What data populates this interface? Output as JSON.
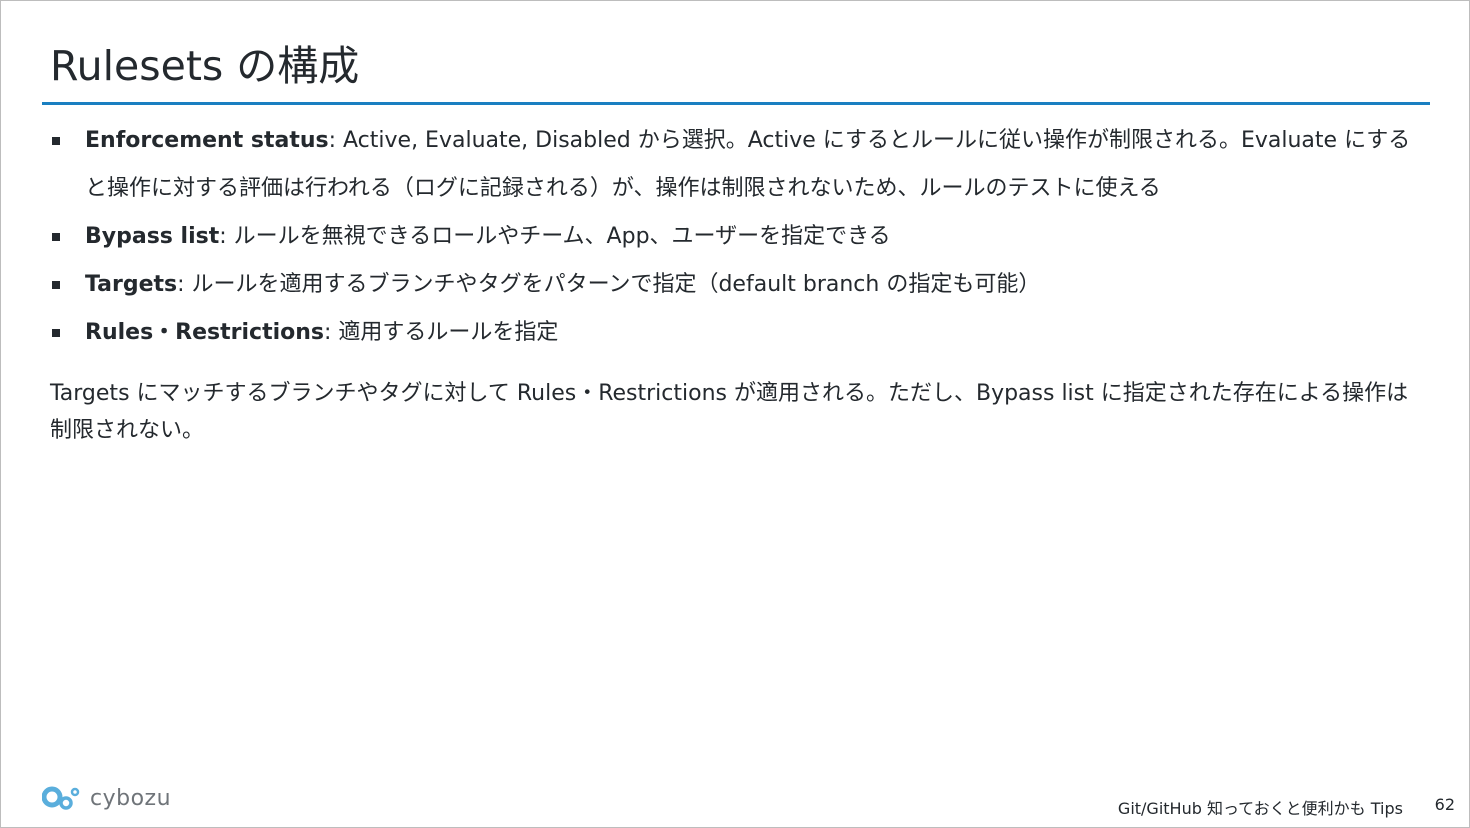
{
  "slide": {
    "title": "Rulesets の構成",
    "bullets": [
      {
        "term": "Enforcement status",
        "text": ": Active, Evaluate, Disabled から選択。Active にするとルールに従い操作が制限される。Evaluate にすると操作に対する評価は行われる（ログに記録される）が、操作は制限されないため、ルールのテストに使える"
      },
      {
        "term": "Bypass list",
        "text": ": ルールを無視できるロールやチーム、App、ユーザーを指定できる"
      },
      {
        "term": "Targets",
        "text": ": ルールを適用するブランチやタグをパターンで指定（default branch の指定も可能）"
      },
      {
        "term": "Rules・Restrictions",
        "text": ": 適用するルールを指定"
      }
    ],
    "note": "Targets にマッチするブランチやタグに対して Rules・Restrictions が適用される。ただし、Bypass list に指定された存在による操作は制限されない。"
  },
  "footer": {
    "logo_text": "cybozu",
    "logo_icon": "cybozu-logo-icon",
    "title": "Git/GitHub 知っておくと便利かも Tips",
    "page_number": "62"
  },
  "colors": {
    "accent": "#1a7fc1",
    "text": "#24292e",
    "logo": "#5aaedc"
  }
}
